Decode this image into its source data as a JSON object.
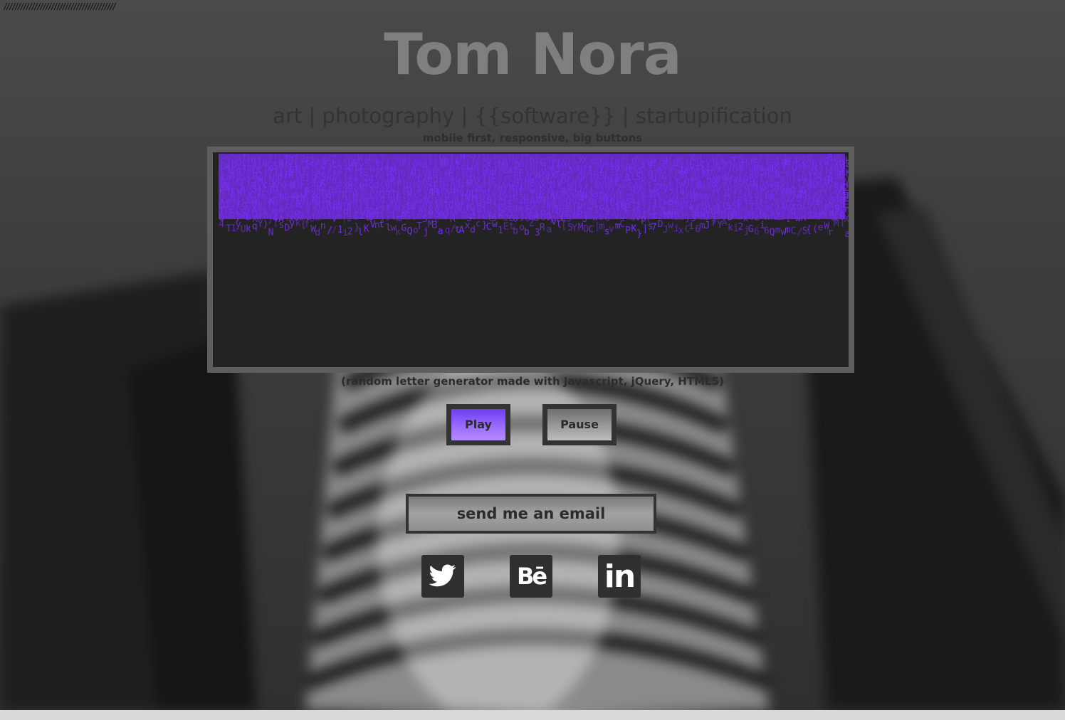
{
  "header": {
    "slashes": "////////////////////////////////////////",
    "name": "Tom Nora",
    "tagline": "art | photography | {{software}} | startupification",
    "subtagline": "mobile first, responsive, big buttons"
  },
  "demo": {
    "caption": "(random letter generator made with Javascript, jQuery, HTML5)",
    "accent": "#7b2ff7",
    "play_label": "Play",
    "pause_label": "Pause"
  },
  "contact": {
    "email_label": "send me an email"
  },
  "social": [
    {
      "name": "twitter-icon"
    },
    {
      "name": "behance-icon",
      "glyph": "Bē"
    },
    {
      "name": "linkedin-icon",
      "glyph": "in"
    }
  ]
}
